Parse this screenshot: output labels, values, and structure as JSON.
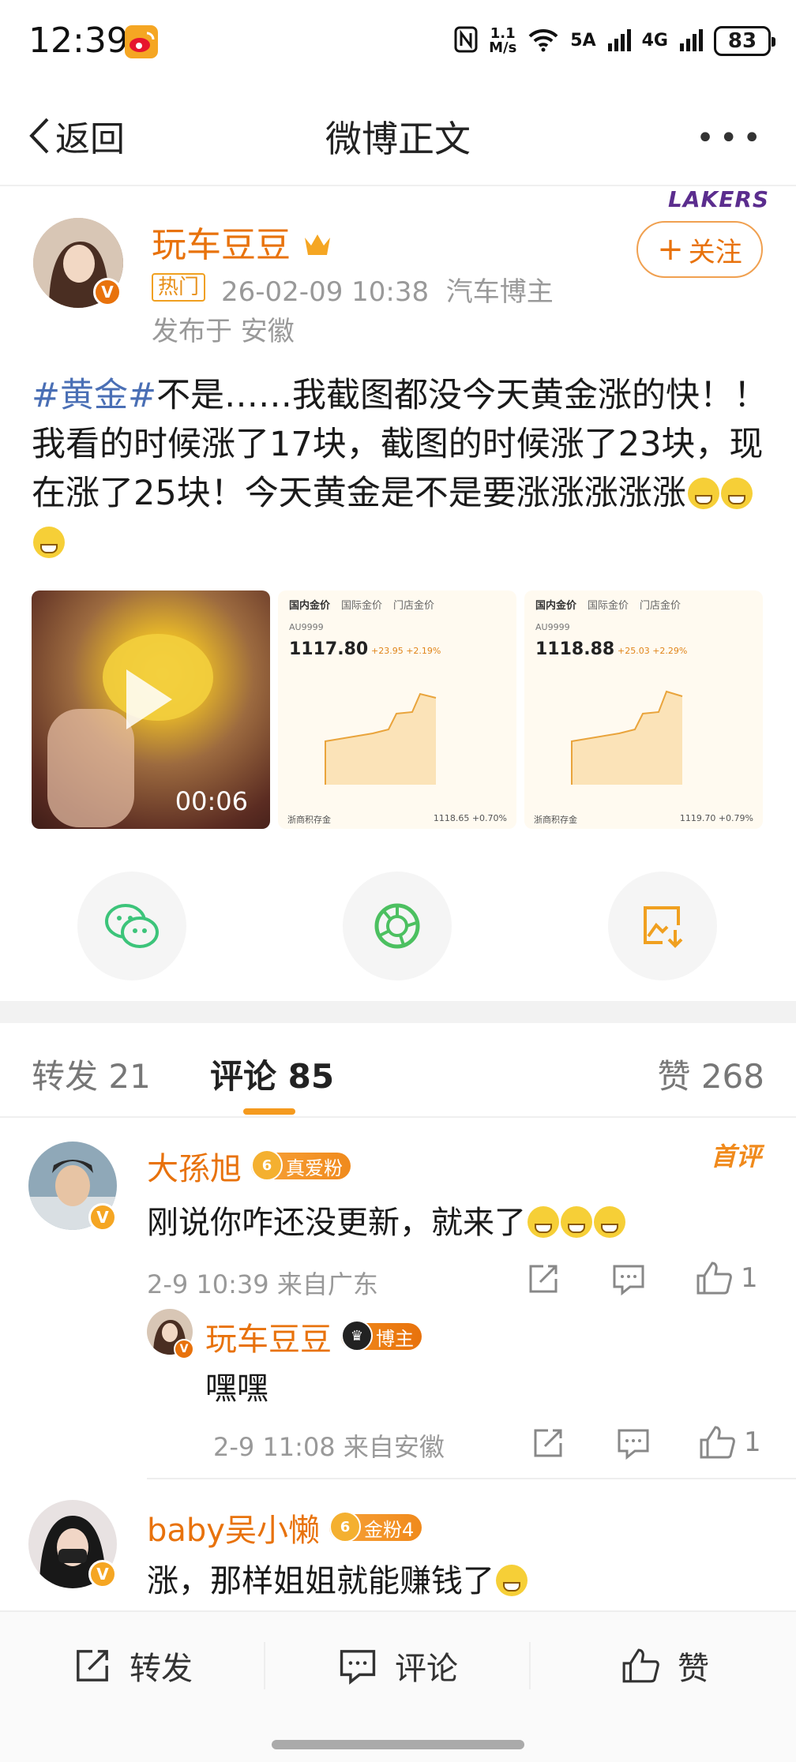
{
  "status_bar": {
    "time": "12:39",
    "net_speed": "1.1\nM/s",
    "sig1": "5A",
    "sig2": "4G",
    "battery": "83"
  },
  "nav": {
    "back_label": "返回",
    "title": "微博正文"
  },
  "post": {
    "author": "玩车豆豆",
    "hot_tag": "热门",
    "meta": "26-02-09 10:38  汽车博主",
    "location": "发布于 安徽",
    "team_badge": "LAKERS",
    "follow_label": "关注",
    "hashtag": "#黄金#",
    "text": "不是……我截图都没今天黄金涨的快！！我看的时候涨了17块，截图的时候涨了23块，现在涨了25块！今天黄金是不是要涨涨涨涨涨",
    "video_duration": "00:06",
    "shots": [
      {
        "tabs": [
          "国内金价",
          "国际金价",
          "门店金价"
        ],
        "code": "AU9999",
        "price": "1117.80",
        "change": "+23.95  +2.19%",
        "footer_left": "浙商积存金",
        "footer_right": "1118.65 +0.70%"
      },
      {
        "tabs": [
          "国内金价",
          "国际金价",
          "门店金价"
        ],
        "code": "AU9999",
        "price": "1118.88",
        "change": "+25.03  +2.29%",
        "footer_left": "浙商积存金",
        "footer_right": "1119.70 +0.79%"
      }
    ]
  },
  "share": {
    "icons": [
      "wechat-icon",
      "moments-icon",
      "save-image-icon"
    ]
  },
  "tabs": {
    "repost": "转发 21",
    "comment": "评论 85",
    "like": "赞 268"
  },
  "comments": [
    {
      "name": "大孫旭",
      "fan_label": "真爱粉",
      "fan_level": "6",
      "first_label": "首评",
      "text": "刚说你咋还没更新，就来了",
      "meta": "2-9 10:39 来自广东",
      "likes": "1",
      "reply": {
        "name": "玩车豆豆",
        "badge": "博主",
        "text": "嘿嘿",
        "meta": "2-9 11:08 来自安徽",
        "likes": "1"
      }
    },
    {
      "name": "baby吴小懒",
      "fan_label": "金粉4",
      "fan_level": "6",
      "text": "涨，那样姐姐就能赚钱了"
    }
  ],
  "bottom_bar": {
    "repost": "转发",
    "comment": "评论",
    "like": "赞"
  },
  "colors": {
    "accent": "#e8720c",
    "tag_blue": "#4a6fb5",
    "weibo_orange": "#f5a623"
  }
}
